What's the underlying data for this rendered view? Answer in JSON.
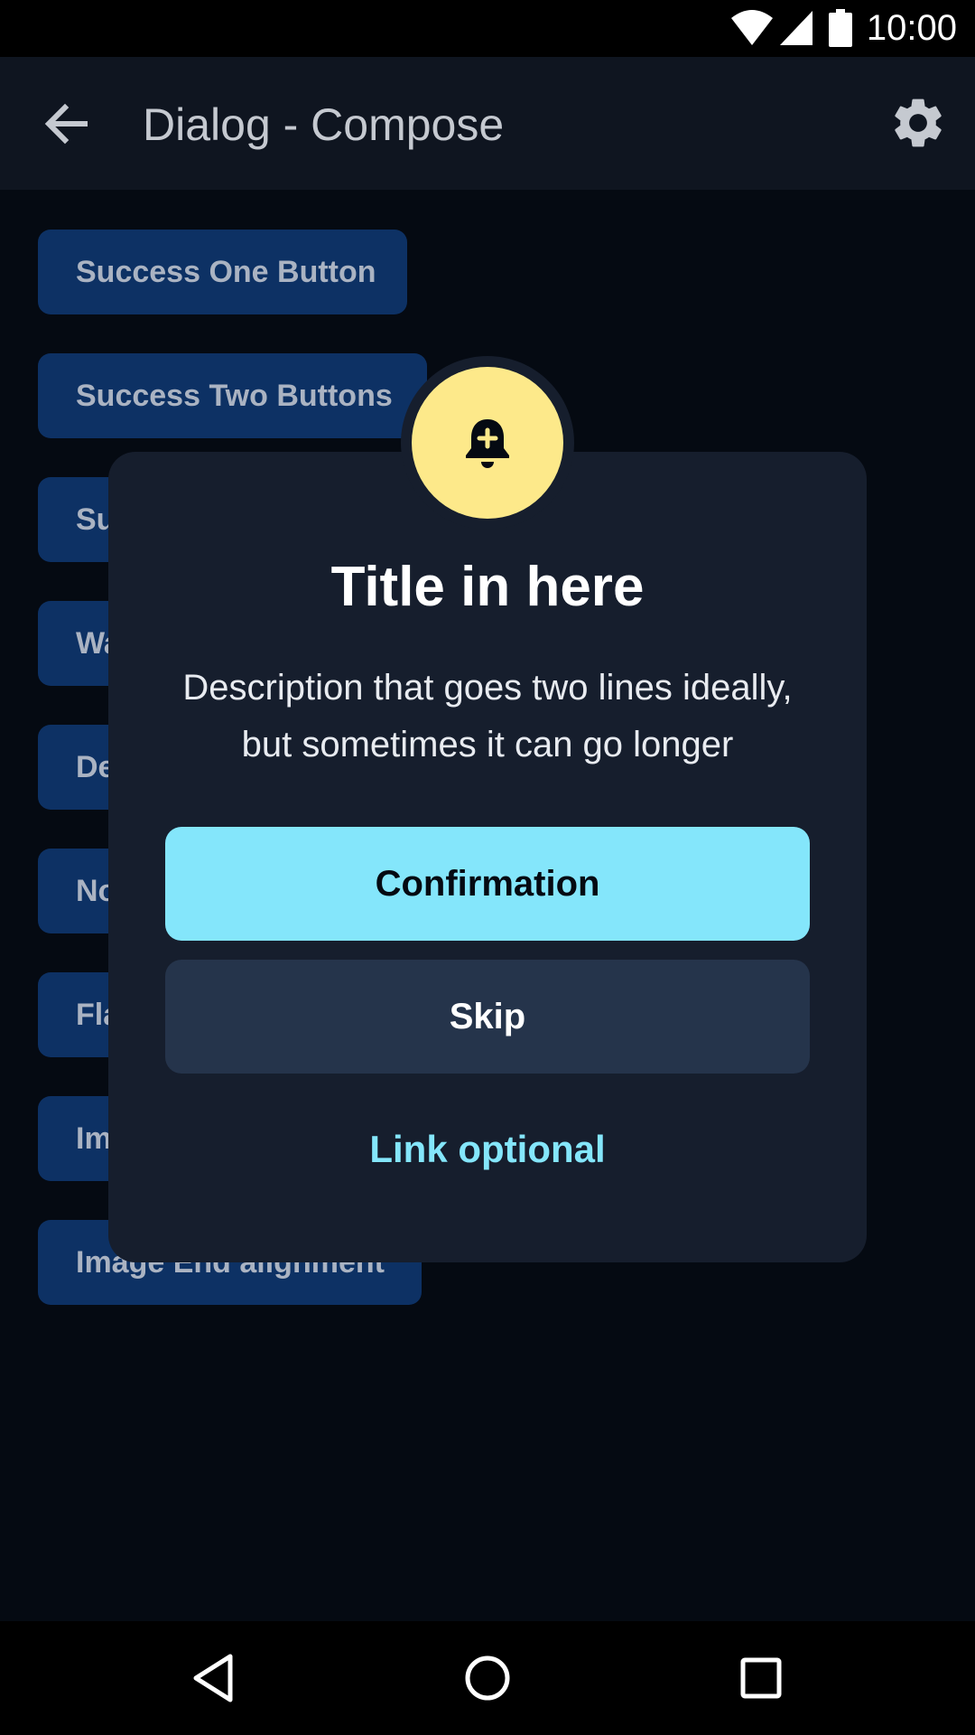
{
  "status_bar": {
    "time": "10:00",
    "icons": [
      "wifi-icon",
      "signal-icon",
      "battery-icon"
    ]
  },
  "app_bar": {
    "title": "Dialog - Compose",
    "back_icon": "arrow-back-icon",
    "settings_icon": "gear-icon"
  },
  "list": {
    "items": [
      "Success One Button",
      "Success Two Buttons",
      "Su",
      "Wa",
      "De",
      "No",
      "Fla",
      "Im",
      "Image End alignment"
    ]
  },
  "dialog": {
    "badge_icon": "bell-plus-icon",
    "title": "Title in here",
    "description": "Description that goes two lines ideally, but sometimes it can go longer",
    "confirm_label": "Confirmation",
    "skip_label": "Skip",
    "link_label": "Link optional"
  },
  "nav_bar": {
    "icons": [
      "back-triangle-icon",
      "home-circle-icon",
      "recents-square-icon"
    ]
  },
  "colors": {
    "background": "#050a12",
    "app_bar": "#0f1520",
    "list_button": "#0d3164",
    "dialog": "#161e2d",
    "badge": "#fde98a",
    "accent": "#84e6fb",
    "secondary_button": "#25344b"
  }
}
